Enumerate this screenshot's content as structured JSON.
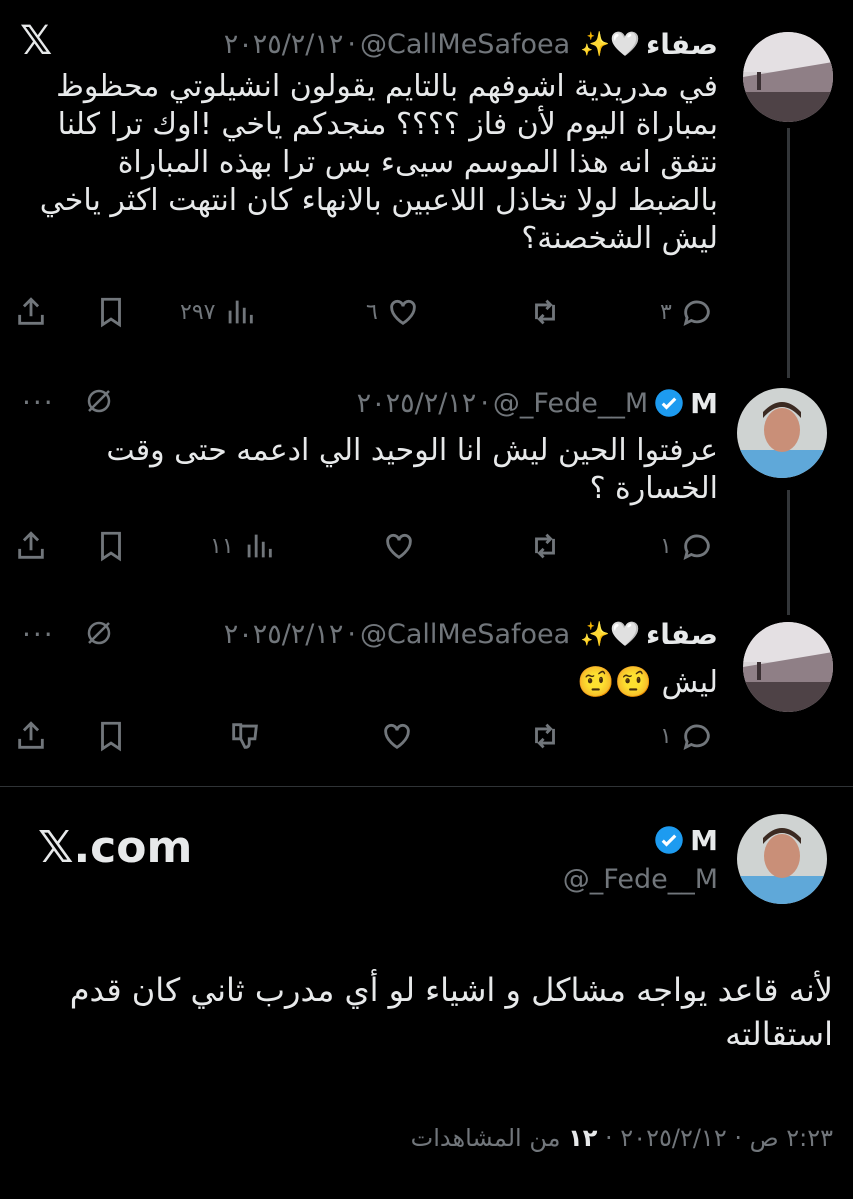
{
  "app": {
    "logo": "𝕏",
    "brand": "𝕏.com"
  },
  "tweets": [
    {
      "name": "صفاء",
      "badge": "✨🤍",
      "handle": "@CallMeSafoea",
      "dot": "·",
      "date": "٢٠٢٥/٢/١٢",
      "text": "في مدريدية اشوفهم بالتايم يقولون انشيلوتي محظوظ بمباراة اليوم لأن فاز ؟؟؟؟ منجدكم ياخي !اوك ترا كلنا نتفق انه هذا الموسم سيىء بس ترا بهذه المباراة بالضبط لولا تخاذل اللاعبين بالانهاء كان انتهت اكثر ياخي ليش الشخصنة؟",
      "replies": "٣",
      "likes": "٦",
      "views": "٢٩٧"
    },
    {
      "name": "M",
      "handle": "@_Fede__M",
      "dot": "·",
      "date": "٢٠٢٥/٢/١٢",
      "text": "عرفتوا الحين ليش انا الوحيد الي ادعمه حتى وقت الخسارة ؟",
      "replies": "١",
      "likes": "",
      "views": "١١",
      "more": "···"
    },
    {
      "name": "صفاء",
      "badge": "✨🤍",
      "handle": "@CallMeSafoea",
      "dot": "·",
      "date": "٢٠٢٥/٢/١٢",
      "text": "ليش 🤨🤨",
      "replies": "١",
      "more": "···"
    },
    {
      "name": "M",
      "handle": "@_Fede__M",
      "text": "لأنه قاعد يواجه مشاكل و اشياء لو أي مدرب ثاني كان قدم استقالته",
      "meta": "٢:٢٣ ص · ٢٠٢٥/٢/١٢",
      "views_count": "١٢",
      "views_label": "من المشاهدات"
    }
  ]
}
